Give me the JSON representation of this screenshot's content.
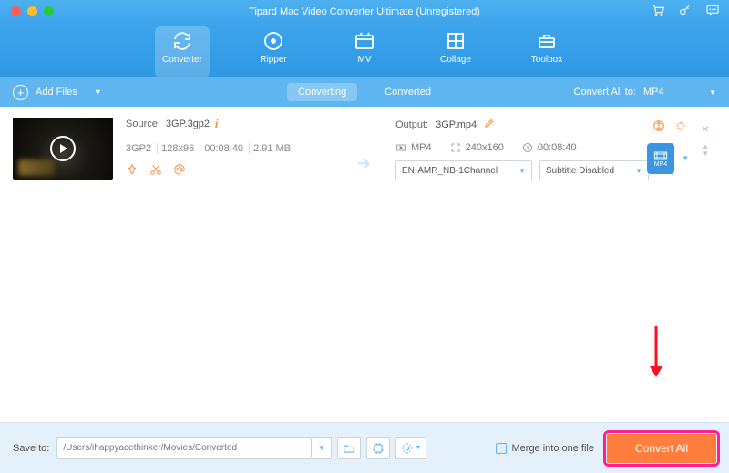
{
  "window": {
    "title": "Tipard Mac Video Converter Ultimate (Unregistered)"
  },
  "tabs": {
    "converter": "Converter",
    "ripper": "Ripper",
    "mv": "MV",
    "collage": "Collage",
    "toolbox": "Toolbox"
  },
  "toolbar": {
    "add_files": "Add Files",
    "converting": "Converting",
    "converted": "Converted",
    "convert_all_to": "Convert All to:",
    "format": "MP4"
  },
  "item": {
    "source_label": "Source:",
    "source_name": "3GP.3gp2",
    "codec": "3GP2",
    "resolution": "128x96",
    "duration": "00:08:40",
    "size": "2.91 MB",
    "output_label": "Output:",
    "output_name": "3GP.mp4",
    "out_format": "MP4",
    "out_resolution": "240x160",
    "out_duration": "00:08:40",
    "audio_select": "EN-AMR_NB-1Channel",
    "subtitle_select": "Subtitle Disabled",
    "badge": "MP4"
  },
  "footer": {
    "save_to_label": "Save to:",
    "path": "/Users/ihappyacethinker/Movies/Converted",
    "merge_label": "Merge into one file",
    "convert_btn": "Convert All"
  }
}
